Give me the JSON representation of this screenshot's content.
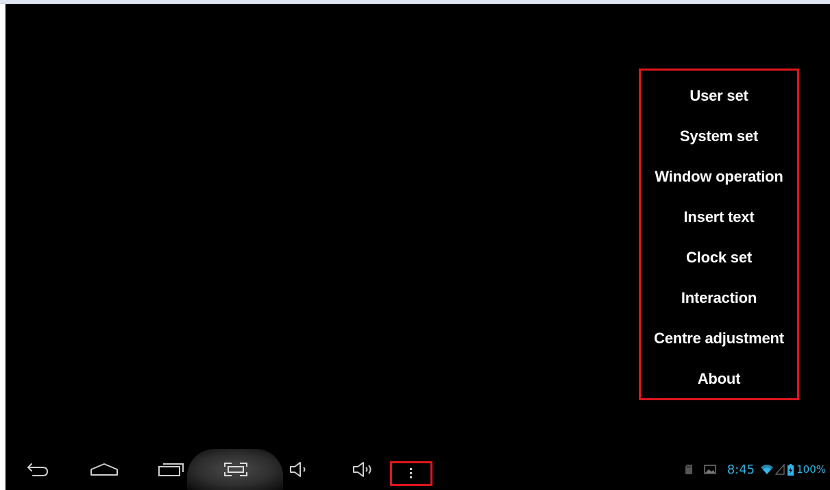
{
  "menu": {
    "items": [
      {
        "label": "User set"
      },
      {
        "label": "System set"
      },
      {
        "label": "Window operation"
      },
      {
        "label": "Insert text"
      },
      {
        "label": "Clock set"
      },
      {
        "label": "Interaction"
      },
      {
        "label": "Centre adjustment"
      },
      {
        "label": "About"
      }
    ]
  },
  "navbar": {
    "buttons": [
      {
        "icon": "back-icon"
      },
      {
        "icon": "home-icon"
      },
      {
        "icon": "recent-apps-icon"
      },
      {
        "icon": "screenshot-icon"
      },
      {
        "icon": "volume-down-icon"
      },
      {
        "icon": "volume-up-icon"
      },
      {
        "icon": "overflow-menu-icon"
      }
    ]
  },
  "status": {
    "time": "8:45",
    "battery": "100%",
    "icons": [
      "sd-card-icon",
      "gallery-icon",
      "wifi-icon",
      "signal-icon",
      "battery-icon"
    ]
  },
  "colors": {
    "highlight": "#e0161b",
    "accent": "#33b5e5",
    "background": "#000000"
  }
}
